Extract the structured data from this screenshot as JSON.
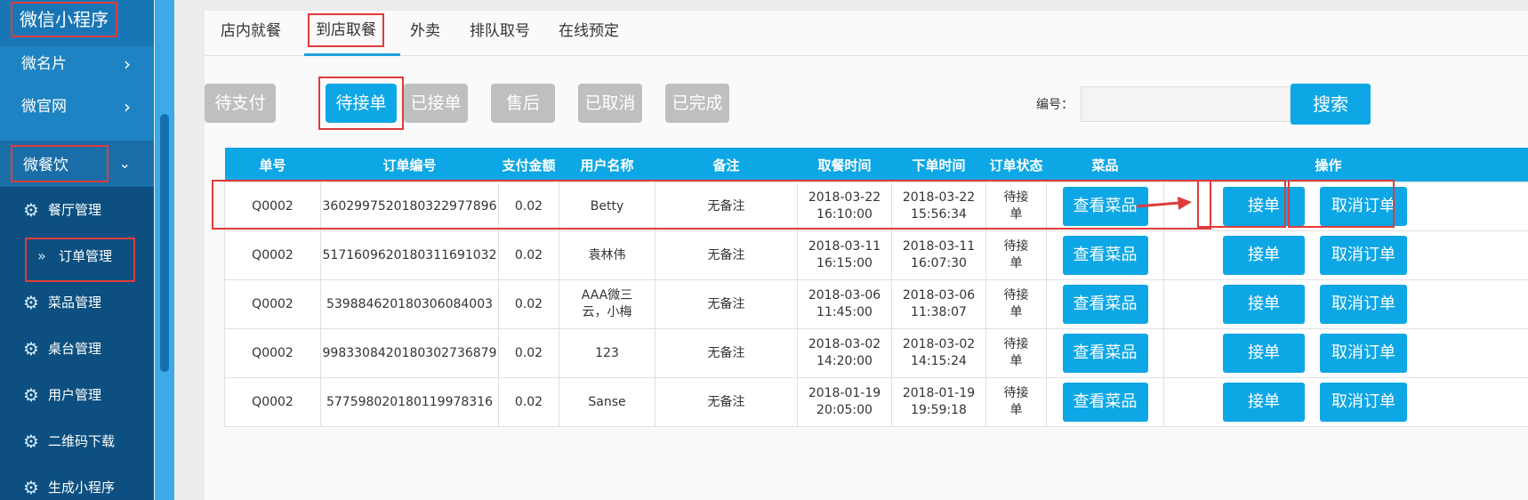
{
  "sidebar": {
    "brand": "微信小程序",
    "items": [
      {
        "label": "微名片"
      },
      {
        "label": "微官网"
      },
      {
        "label": "微餐饮"
      }
    ],
    "sub_items": [
      {
        "label": "餐厅管理"
      },
      {
        "label": "订单管理"
      },
      {
        "label": "菜品管理"
      },
      {
        "label": "桌台管理"
      },
      {
        "label": "用户管理"
      },
      {
        "label": "二维码下载"
      },
      {
        "label": "生成小程序"
      }
    ]
  },
  "tabs": [
    {
      "label": "店内就餐"
    },
    {
      "label": "到店取餐"
    },
    {
      "label": "外卖"
    },
    {
      "label": "排队取号"
    },
    {
      "label": "在线预定"
    }
  ],
  "filters": [
    {
      "label": "待支付"
    },
    {
      "label": "待接单"
    },
    {
      "label": "已接单"
    },
    {
      "label": "售后"
    },
    {
      "label": "已取消"
    },
    {
      "label": "已完成"
    }
  ],
  "search": {
    "label": "编号：",
    "button": "搜索",
    "value": ""
  },
  "table": {
    "headers": [
      "单号",
      "订单编号",
      "支付金额",
      "用户名称",
      "备注",
      "取餐时间",
      "下单时间",
      "订单状态",
      "菜品",
      "操作"
    ],
    "view_label": "查看菜品",
    "accept_label": "接单",
    "cancel_label": "取消订单",
    "rows": [
      {
        "no": "Q0002",
        "order_id": "3602997520180322977896",
        "amount": "0.02",
        "user": "Betty",
        "note": "无备注",
        "pickup_date": "2018-03-22",
        "pickup_time": "16:10:00",
        "order_date": "2018-03-22",
        "order_time": "15:56:34",
        "status1": "待接",
        "status2": "单"
      },
      {
        "no": "Q0002",
        "order_id": "5171609620180311691032",
        "amount": "0.02",
        "user": "袁林伟",
        "note": "无备注",
        "pickup_date": "2018-03-11",
        "pickup_time": "16:15:00",
        "order_date": "2018-03-11",
        "order_time": "16:07:30",
        "status1": "待接",
        "status2": "单"
      },
      {
        "no": "Q0002",
        "order_id": "539884620180306084003",
        "amount": "0.02",
        "user": "AAA微三云，小梅",
        "note": "无备注",
        "pickup_date": "2018-03-06",
        "pickup_time": "11:45:00",
        "order_date": "2018-03-06",
        "order_time": "11:38:07",
        "status1": "待接",
        "status2": "单"
      },
      {
        "no": "Q0002",
        "order_id": "9983308420180302736879",
        "amount": "0.02",
        "user": "123",
        "note": "无备注",
        "pickup_date": "2018-03-02",
        "pickup_time": "14:20:00",
        "order_date": "2018-03-02",
        "order_time": "14:15:24",
        "status1": "待接",
        "status2": "单"
      },
      {
        "no": "Q0002",
        "order_id": "577598020180119978316",
        "amount": "0.02",
        "user": "Sanse",
        "note": "无备注",
        "pickup_date": "2018-01-19",
        "pickup_time": "20:05:00",
        "order_date": "2018-01-19",
        "order_time": "19:59:18",
        "status1": "待接",
        "status2": "单"
      }
    ]
  }
}
